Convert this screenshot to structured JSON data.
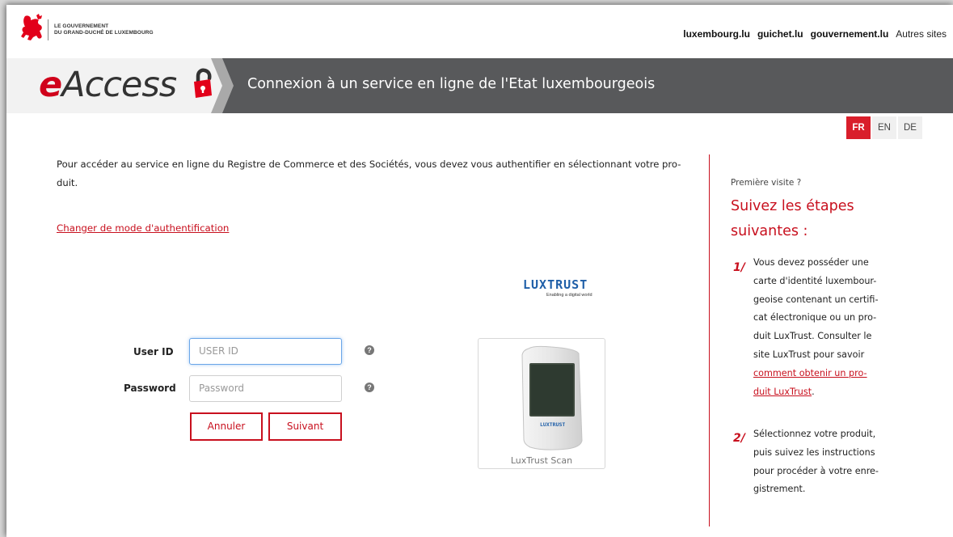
{
  "header": {
    "gov_line1": "LE GOUVERNEMENT",
    "gov_line2": "DU GRAND-DUCHÉ DE LUXEMBOURG",
    "links": [
      "luxembourg.lu",
      "guichet.lu",
      "gouvernement.lu"
    ],
    "other_sites": "Autres sites"
  },
  "banner": {
    "logo_e": "e",
    "logo_rest": "Access",
    "title": "Connexion à un service en ligne de l'Etat luxembourgeois"
  },
  "languages": {
    "fr": "FR",
    "en": "EN",
    "de": "DE",
    "active": "FR"
  },
  "main": {
    "intro_line1": "Pour accéder au service en ligne du Registre de Commerce et des Sociétés, vous devez vous authentifier en sélectionnant votre pro-",
    "intro_line2": "duit.",
    "change_link": "Changer de mode d'authentification",
    "luxtrust_logo": "LUXTRUST",
    "luxtrust_tagline": "Enabling a digital world"
  },
  "form": {
    "userid_label": "User ID",
    "userid_placeholder": "USER ID",
    "password_label": "Password",
    "password_placeholder": "Password",
    "cancel_label": "Annuler",
    "next_label": "Suivant",
    "help_icon": "question-circle-icon"
  },
  "device": {
    "screen_brand": "LUXTRUST",
    "caption": "LuxTrust Scan"
  },
  "sidebar": {
    "first_visit": "Première visite ?",
    "title_line1": "Suivez les étapes",
    "title_line2": "suivantes :",
    "steps": [
      {
        "num": "1/",
        "lines": [
          "Vous devez posséder une",
          "carte d'identité luxembour-",
          "geoise contenant un certifi-",
          "cat électronique ou un pro-",
          "duit LuxTrust. Consulter le",
          "site LuxTrust pour savoir"
        ],
        "link_line1": "comment obtenir un pro-",
        "link_line2": "duit LuxTrust",
        "link_suffix": "."
      },
      {
        "num": "2/",
        "lines": [
          "Sélectionnez votre produit,",
          "puis suivez les instructions",
          "pour procéder à votre enre-",
          "gistrement."
        ]
      }
    ]
  },
  "colors": {
    "accent_red": "#c8101e",
    "banner_gray": "#58595b",
    "lang_active": "#d91e2b"
  }
}
